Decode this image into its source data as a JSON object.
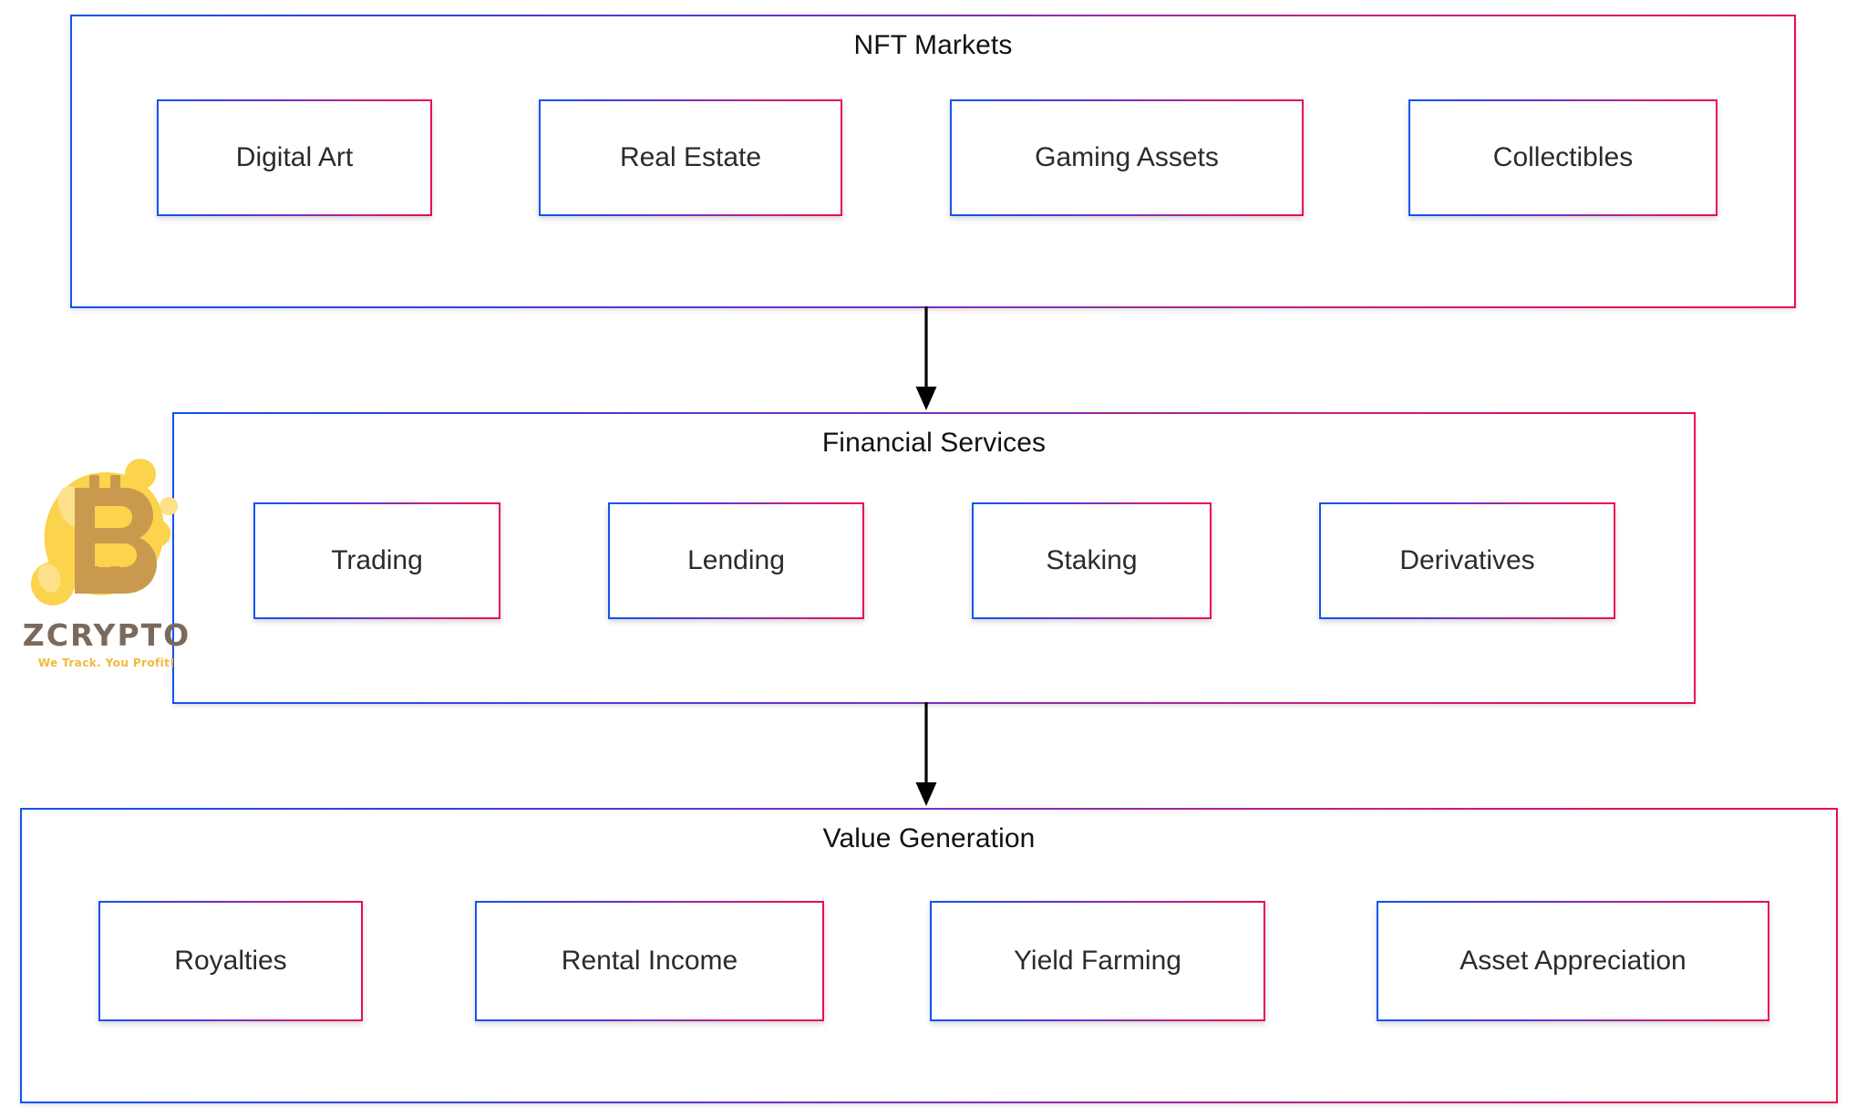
{
  "diagram": {
    "title_flow": "NFT Markets to Financial Services to Value Generation",
    "accent_start_color": "#1154f2",
    "accent_end_color": "#ec0b4f",
    "arrow_color": "#000000",
    "sections": [
      {
        "id": "nft-markets",
        "title": "NFT Markets",
        "nodes": [
          {
            "label": "Digital Art"
          },
          {
            "label": "Real Estate"
          },
          {
            "label": "Gaming Assets"
          },
          {
            "label": "Collectibles"
          }
        ]
      },
      {
        "id": "financial-services",
        "title": "Financial Services",
        "nodes": [
          {
            "label": "Trading"
          },
          {
            "label": "Lending"
          },
          {
            "label": "Staking"
          },
          {
            "label": "Derivatives"
          }
        ]
      },
      {
        "id": "value-generation",
        "title": "Value Generation",
        "nodes": [
          {
            "label": "Royalties"
          },
          {
            "label": "Rental Income"
          },
          {
            "label": "Yield Farming"
          },
          {
            "label": "Asset Appreciation"
          }
        ]
      }
    ],
    "connectors": [
      {
        "id": "connector-1",
        "from": "nft-markets",
        "to": "financial-services",
        "style": "down-arrow"
      },
      {
        "id": "connector-2",
        "from": "financial-services",
        "to": "value-generation",
        "style": "down-arrow"
      }
    ]
  },
  "watermark": {
    "wordmark": "ZCRYPTO",
    "tagline": "We Track. You Profit!",
    "blob_color": "#fbd34d",
    "blob_light_color": "#fde08a",
    "symbol_color": "#c99a4e",
    "symbol": "bitcoin-b"
  }
}
